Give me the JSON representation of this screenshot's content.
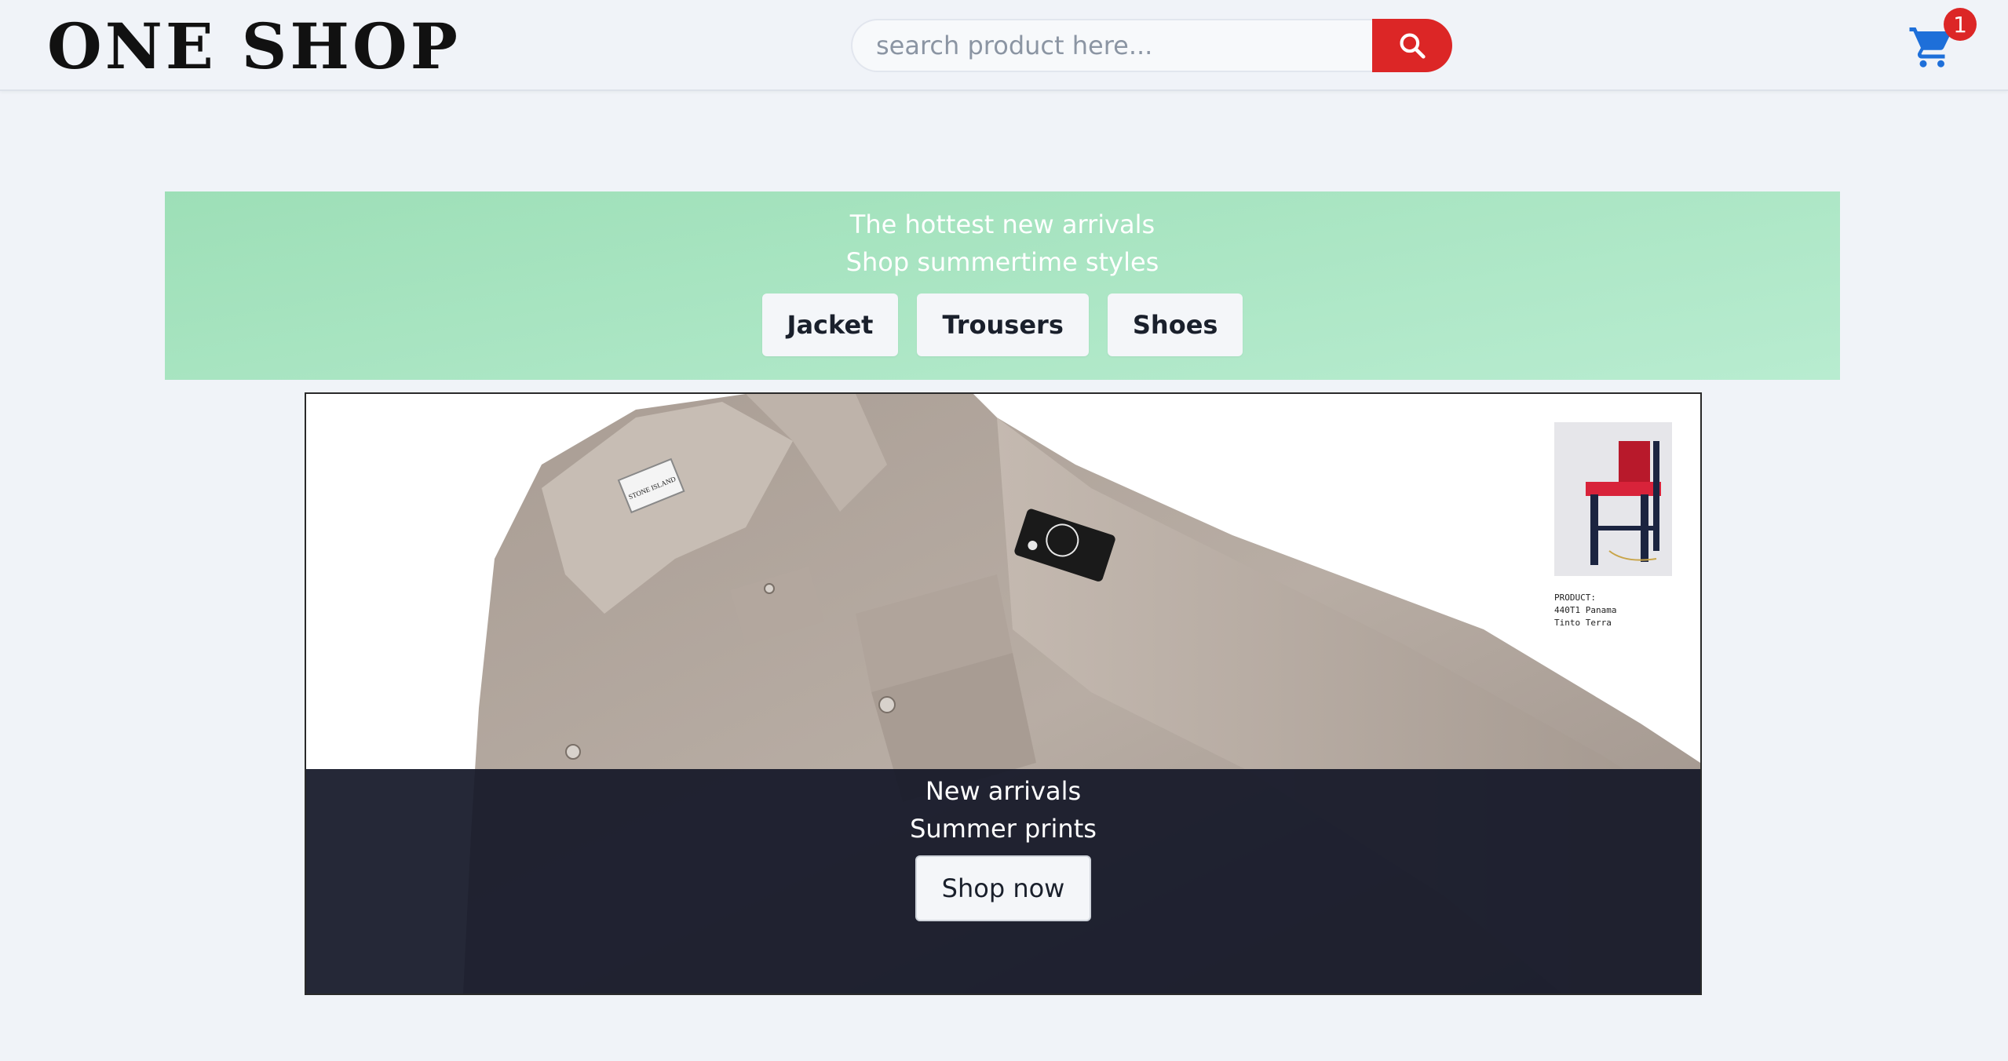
{
  "header": {
    "logo_text": "ONE SHOP",
    "search_placeholder": "search product here...",
    "cart_count": "1"
  },
  "promo": {
    "line1": "The hottest new arrivals",
    "line2": "Shop summertime styles",
    "categories": [
      "Jacket",
      "Trousers",
      "Shoes"
    ]
  },
  "hero": {
    "label_brand": "STONE ISLAND",
    "product_tag": {
      "line1": "PRODUCT:",
      "line2": "440T1 Panama",
      "line3": "Tinto Terra"
    },
    "overlay_line1": "New arrivals",
    "overlay_line2": "Summer prints",
    "cta_label": "Shop now"
  },
  "colors": {
    "accent_red": "#dc2626",
    "cart_blue": "#1e6fd9",
    "promo_green": "#a8e6c2",
    "overlay_navy": "#141828"
  }
}
